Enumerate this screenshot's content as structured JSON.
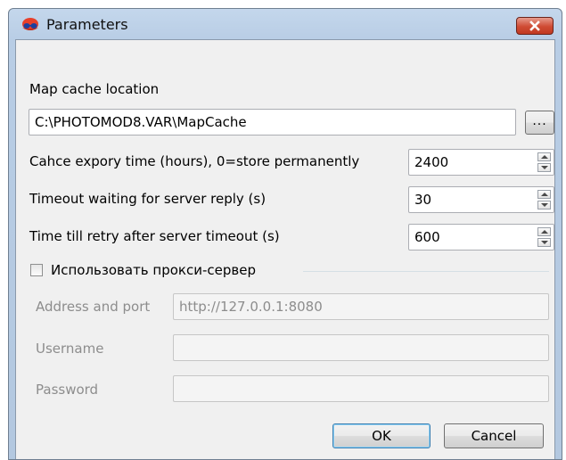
{
  "window": {
    "title": "Parameters"
  },
  "map_cache": {
    "label": "Map cache location",
    "path": "C:\\PHOTOMOD8.VAR\\MapCache",
    "browse_label": "..."
  },
  "settings": [
    {
      "label": "Cahce expory time (hours), 0=store permanently",
      "value": "2400"
    },
    {
      "label": "Timeout waiting for server reply (s)",
      "value": "30"
    },
    {
      "label": "Time till retry after server timeout (s)",
      "value": "600"
    }
  ],
  "proxy": {
    "checkbox_label": "Использовать прокси-сервер",
    "checked": false,
    "address_label": "Address and port",
    "address_value": "http://127.0.0.1:8080",
    "username_label": "Username",
    "username_value": "",
    "password_label": "Password",
    "password_value": ""
  },
  "buttons": {
    "ok": "OK",
    "cancel": "Cancel"
  },
  "colors": {
    "title_bar": "#b8cde5",
    "close_button": "#cf4b33",
    "dialog_background": "#f0f0f0",
    "disabled_text": "#8d8d8d"
  }
}
